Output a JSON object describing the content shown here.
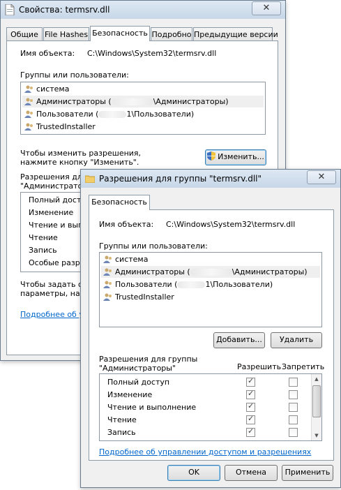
{
  "back_window": {
    "title": "Свойства: termsrv.dll",
    "close_glyph": "✕",
    "tabs": [
      {
        "label": "Общие"
      },
      {
        "label": "File Hashes"
      },
      {
        "label": "Безопасность"
      },
      {
        "label": "Подробно"
      },
      {
        "label": "Предыдущие версии"
      }
    ],
    "object_label": "Имя объекта:",
    "object_value": "C:\\Windows\\System32\\termsrv.dll",
    "groups_label": "Группы или пользователи:",
    "users": [
      {
        "pre": "система",
        "post": ""
      },
      {
        "pre": "Администраторы (",
        "post": "\\Администраторы)"
      },
      {
        "pre": "Пользователи (",
        "post": "1\\Пользователи)"
      },
      {
        "pre": "TrustedInstaller",
        "post": ""
      }
    ],
    "change_text_1": "Чтобы изменить разрешения,",
    "change_text_2": "нажмите кнопку \"Изменить\".",
    "change_button": "Изменить...",
    "perms_label_1": "Разрешения для",
    "perms_label_2": "\"Администратор",
    "perms": [
      "Полный доступ",
      "Изменение",
      "Чтение и выпол",
      "Чтение",
      "Запись",
      "Особые разре"
    ],
    "bottom_text_1": "Чтобы задать ос",
    "bottom_text_2": "параметры, наж",
    "more_link": "Подробнее об упра"
  },
  "front_window": {
    "title": "Разрешения для группы \"termsrv.dll\"",
    "close_glyph": "✕",
    "tab": "Безопасность",
    "object_label": "Имя объекта:",
    "object_value": "C:\\Windows\\System32\\termsrv.dll",
    "groups_label": "Группы или пользователи:",
    "users": [
      {
        "pre": "система",
        "post": ""
      },
      {
        "pre": "Администраторы (",
        "post": "\\Администраторы)"
      },
      {
        "pre": "Пользователи (",
        "post": "1\\Пользователи)"
      },
      {
        "pre": "TrustedInstaller",
        "post": ""
      }
    ],
    "add_button": "Добавить...",
    "remove_button": "Удалить",
    "perms_label_1": "Разрешения для группы",
    "perms_label_2": "\"Администраторы\"",
    "allow_header": "Разрешить",
    "deny_header": "Запретить",
    "perms": [
      {
        "name": "Полный доступ",
        "allow": true,
        "deny": false
      },
      {
        "name": "Изменение",
        "allow": true,
        "deny": false
      },
      {
        "name": "Чтение и выполнение",
        "allow": true,
        "deny": false
      },
      {
        "name": "Чтение",
        "allow": true,
        "deny": false
      },
      {
        "name": "Запись",
        "allow": true,
        "deny": false
      }
    ],
    "more_link": "Подробнее об управлении доступом и разрешениях",
    "ok_button": "OK",
    "cancel_button": "Отмена",
    "apply_button": "Применить"
  }
}
